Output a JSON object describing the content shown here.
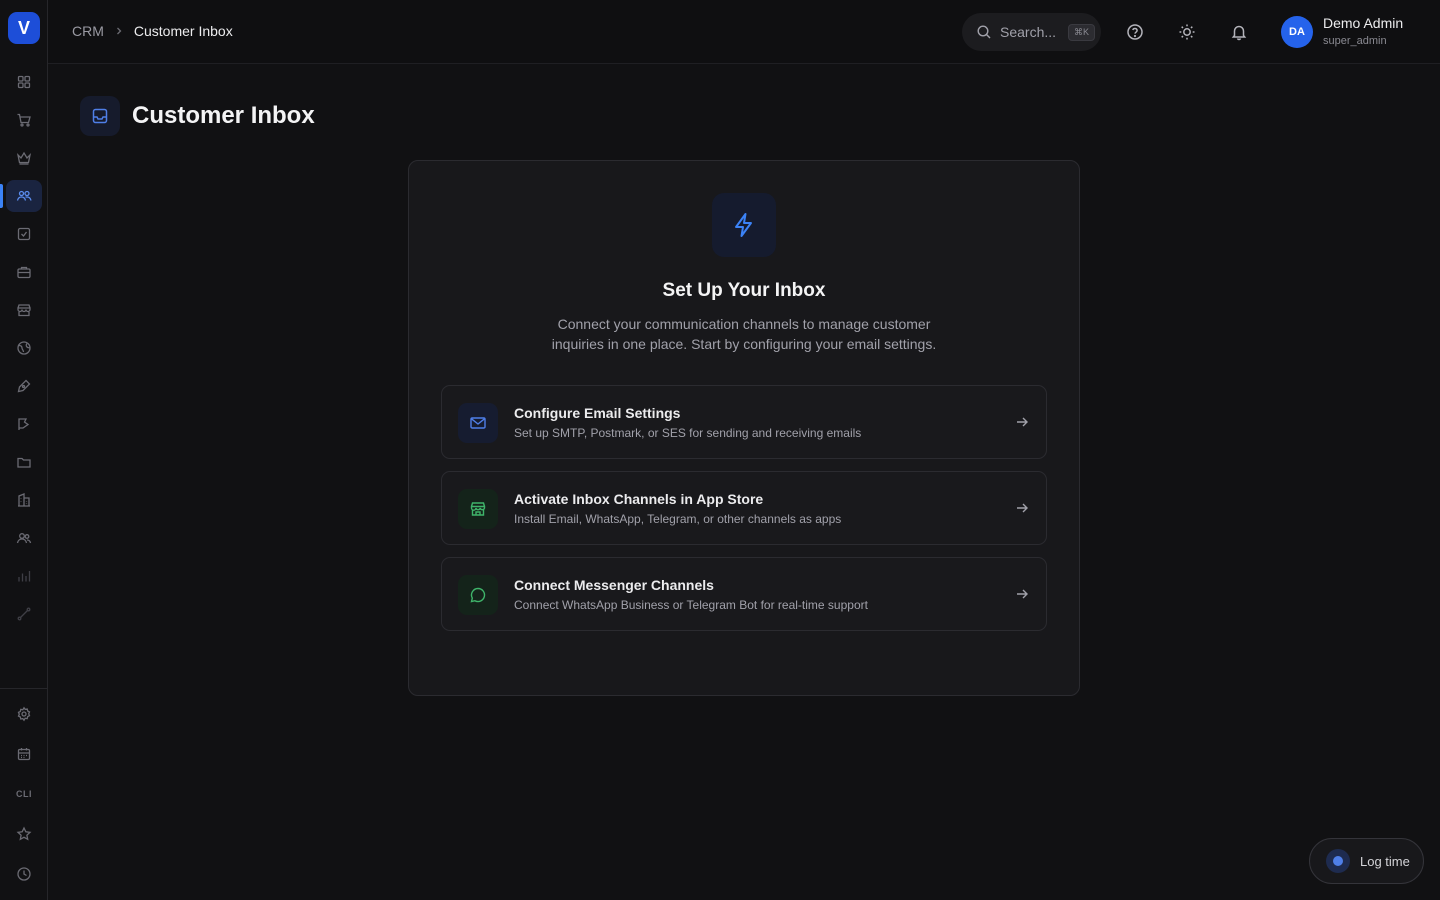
{
  "sidebar": {
    "logo_letter": "V",
    "items": [
      {
        "icon": "grid-icon"
      },
      {
        "icon": "cart-icon"
      },
      {
        "icon": "crown-icon"
      },
      {
        "icon": "users-icon",
        "active": true
      },
      {
        "icon": "checkbox-icon"
      },
      {
        "icon": "briefcase-icon"
      },
      {
        "icon": "store-icon"
      },
      {
        "icon": "globe-icon"
      },
      {
        "icon": "pen-icon"
      },
      {
        "icon": "flag-icon"
      },
      {
        "icon": "folder-icon"
      },
      {
        "icon": "building-icon"
      },
      {
        "icon": "team-icon"
      },
      {
        "icon": "bar-chart-icon"
      },
      {
        "icon": "route-icon"
      }
    ],
    "bottom": {
      "cli_label": "CLI"
    }
  },
  "header": {
    "breadcrumb_root": "CRM",
    "breadcrumb_current": "Customer Inbox",
    "search_placeholder": "Search...",
    "search_shortcut": "⌘K",
    "user_initials": "DA",
    "user_name": "Demo Admin",
    "user_role": "super_admin"
  },
  "page": {
    "title": "Customer Inbox"
  },
  "card": {
    "title": "Set Up Your Inbox",
    "description": "Connect your communication channels to manage customer inquiries in one place. Start by configuring your email settings.",
    "options": [
      {
        "title": "Configure Email Settings",
        "subtitle": "Set up SMTP, Postmark, or SES for sending and receiving emails",
        "icon": "mail-icon",
        "color": "#4f7fe8"
      },
      {
        "title": "Activate Inbox Channels in App Store",
        "subtitle": "Install Email, WhatsApp, Telegram, or other channels as apps",
        "icon": "store-icon",
        "color": "#3fb46a"
      },
      {
        "title": "Connect Messenger Channels",
        "subtitle": "Connect WhatsApp Business or Telegram Bot for real-time support",
        "icon": "message-icon",
        "color": "#3fb46a"
      }
    ]
  },
  "log_time": {
    "label": "Log time"
  },
  "colors": {
    "accent": "#2563eb",
    "background": "#111113"
  }
}
